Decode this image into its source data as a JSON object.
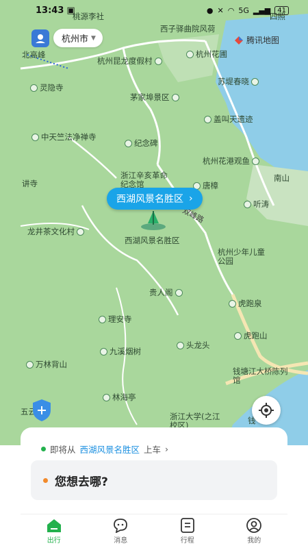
{
  "status_bar": {
    "time": "13:43",
    "battery": "41",
    "network": "5G"
  },
  "map": {
    "city": "杭州市",
    "provider": "腾讯地图",
    "pickup_bubble": "西湖风景名胜区",
    "road_labels": [
      "双峰路"
    ],
    "pois": [
      "桃源李社",
      "西子驿曲院风荷",
      "四照",
      "北高峰",
      "杭州昆龙度假村",
      "杭州花圃",
      "灵隐寺",
      "苏堤春晓",
      "茅家埠景区",
      "盖叫天遗迹",
      "中天竺法净禅寺",
      "纪念碑",
      "杭州花港观鱼",
      "浙江辛亥革命纪念馆",
      "唐樟",
      "南山",
      "讲寺",
      "听涛",
      "龙井茶文化村",
      "西湖风景名胜区",
      "杭州少年儿童公园",
      "贵人阁",
      "虎跑泉",
      "理安寺",
      "虎跑山",
      "头龙头",
      "九溪烟树",
      "万林背山",
      "钱塘江大桥陈列馆",
      "林海亭",
      "五云",
      "浙江大学(之江校区)",
      "钱"
    ]
  },
  "panel": {
    "pickup_prefix": "即将从",
    "pickup_place": "西湖风景名胜区",
    "pickup_suffix": "上车",
    "destination_placeholder": "您想去哪?"
  },
  "tabs": [
    {
      "label": "出行",
      "icon": "home-icon",
      "active": true
    },
    {
      "label": "消息",
      "icon": "message-icon",
      "active": false
    },
    {
      "label": "行程",
      "icon": "trip-icon",
      "active": false
    },
    {
      "label": "我的",
      "icon": "profile-icon",
      "active": false
    }
  ],
  "colors": {
    "accent": "#23b14d",
    "bubble": "#1aa4e8",
    "map_green": "#a9d79c",
    "water": "#8fcde8"
  }
}
